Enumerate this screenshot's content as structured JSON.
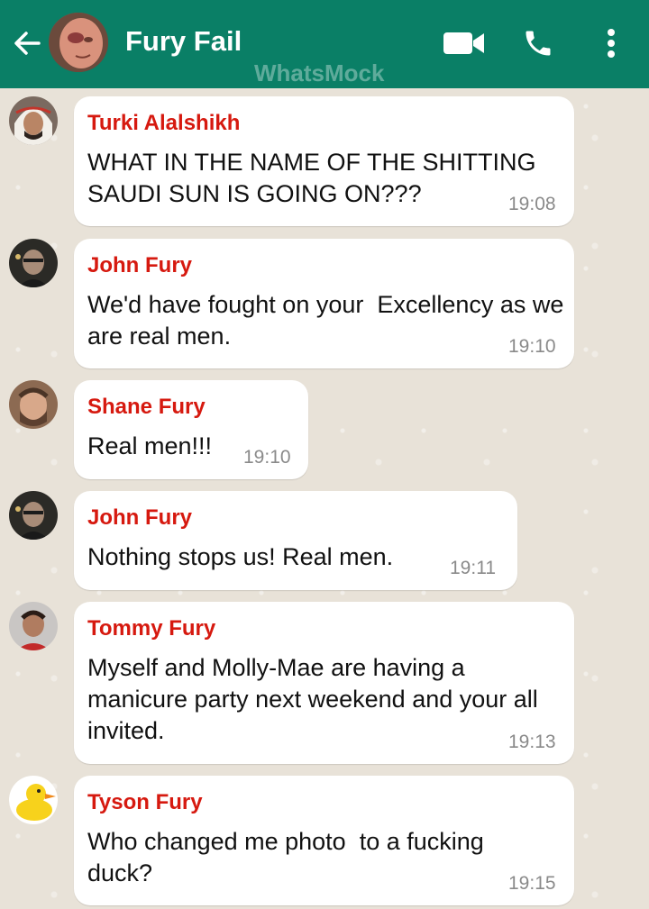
{
  "header": {
    "title": "Fury Fail",
    "watermark": "WhatsMock",
    "background_color": "#0a7f66",
    "icons": [
      "back-arrow-icon",
      "video-call-icon",
      "phone-icon",
      "more-vert-icon"
    ]
  },
  "colors": {
    "sender_name": "#d6190f",
    "bubble": "#ffffff",
    "timestamp": "#8a8a8a",
    "chat_background": "#e8e2d8"
  },
  "messages": [
    {
      "sender": "Turki Alalshikh",
      "text": "WHAT IN THE NAME OF THE SHITTING SAUDI SUN IS GOING ON???",
      "time": "19:08"
    },
    {
      "sender": "John Fury",
      "text": "We'd have fought on your  Excellency as we are real men.",
      "time": "19:10"
    },
    {
      "sender": "Shane Fury",
      "text": "Real men!!!",
      "time": "19:10"
    },
    {
      "sender": "John Fury",
      "text": "Nothing stops us! Real men.",
      "time": "19:11"
    },
    {
      "sender": "Tommy Fury",
      "text": "Myself and Molly-Mae are having a manicure party next weekend and your all invited.",
      "time": "19:13"
    },
    {
      "sender": "Tyson Fury",
      "text": "Who changed me photo  to a fucking duck?",
      "time": "19:15"
    }
  ]
}
